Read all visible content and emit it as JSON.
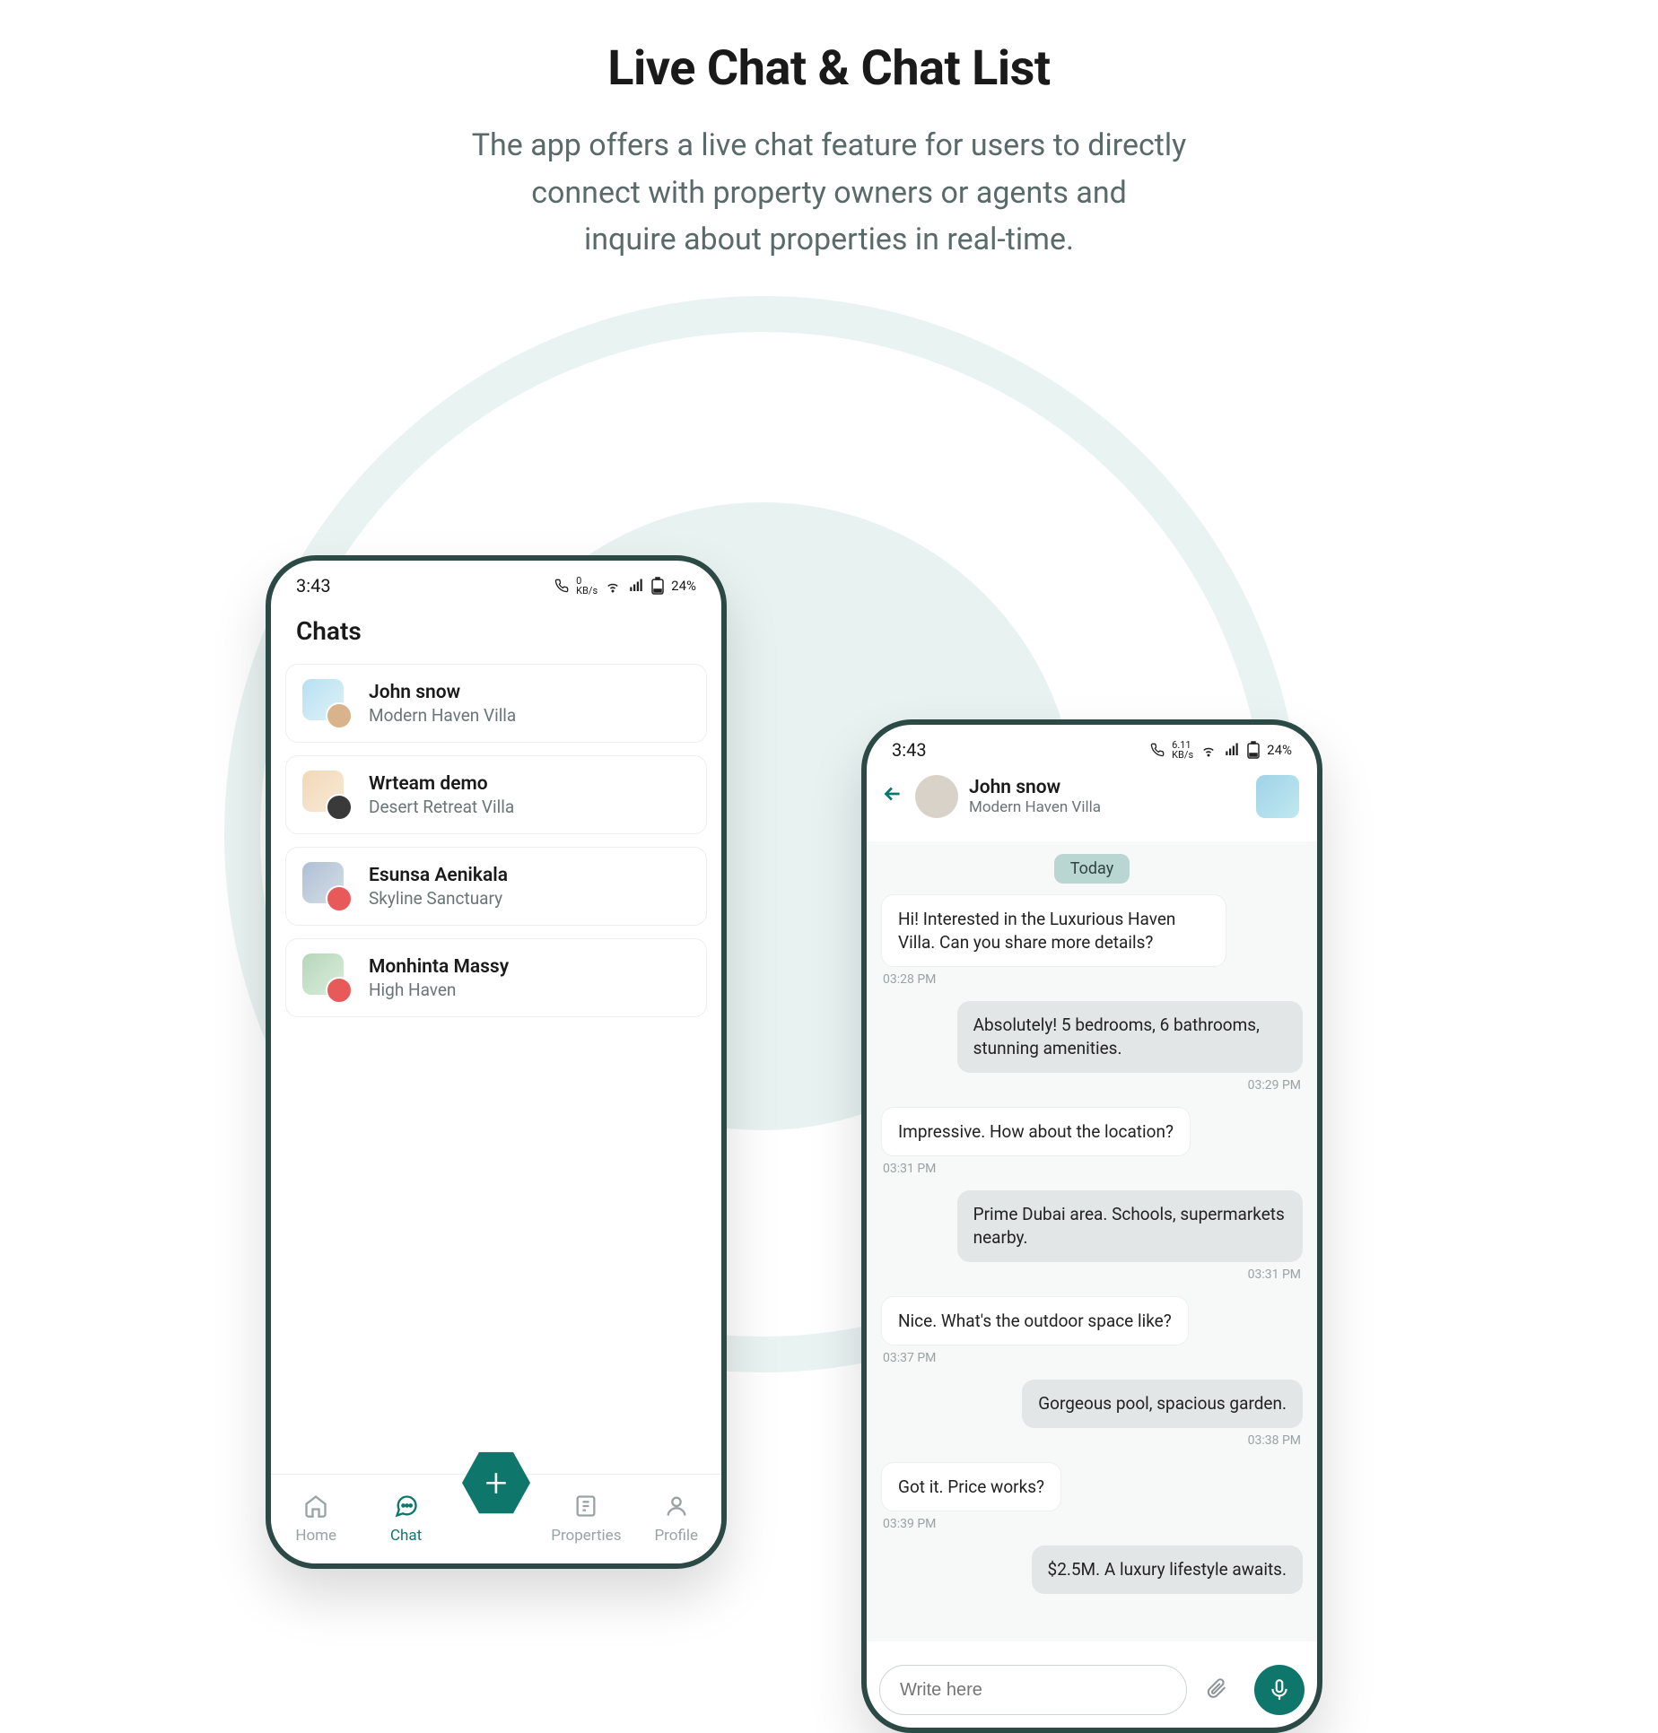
{
  "hero": {
    "title": "Live Chat & Chat List",
    "desc_l1": "The app offers a live chat feature for users to directly",
    "desc_l2": "connect with property owners or agents and",
    "desc_l3": "inquire about properties in real-time."
  },
  "status": {
    "time": "3:43",
    "kb_left": "0",
    "kb_unit": "KB/s",
    "kb_right": "6.11",
    "battery": "24%"
  },
  "chat_list": {
    "title": "Chats",
    "items": [
      {
        "name": "John snow",
        "sub": "Modern Haven Villa"
      },
      {
        "name": "Wrteam demo",
        "sub": "Desert Retreat Villa"
      },
      {
        "name": "Esunsa Aenikala",
        "sub": "Skyline Sanctuary"
      },
      {
        "name": "Monhinta Massy",
        "sub": "High Haven"
      }
    ],
    "nav": {
      "home": "Home",
      "chat": "Chat",
      "properties": "Properties",
      "profile": "Profile"
    }
  },
  "conversation": {
    "name": "John snow",
    "sub": "Modern Haven Villa",
    "day": "Today",
    "messages": [
      {
        "side": "recv",
        "text": "Hi! Interested in the Luxurious Haven Villa. Can you share more details?",
        "time": "03:28 PM"
      },
      {
        "side": "sent",
        "text": "Absolutely! 5 bedrooms, 6 bathrooms, stunning amenities.",
        "time": "03:29 PM"
      },
      {
        "side": "recv",
        "text": "Impressive. How about the location?",
        "time": "03:31 PM"
      },
      {
        "side": "sent",
        "text": "Prime Dubai area. Schools, supermarkets nearby.",
        "time": "03:31 PM"
      },
      {
        "side": "recv",
        "text": "Nice. What's the outdoor space like?",
        "time": "03:37 PM"
      },
      {
        "side": "sent",
        "text": "Gorgeous pool, spacious garden.",
        "time": "03:38 PM"
      },
      {
        "side": "recv",
        "text": "Got it. Price works?",
        "time": "03:39 PM"
      },
      {
        "side": "sent",
        "text": "$2.5M. A luxury lifestyle awaits.",
        "time": ""
      }
    ],
    "composer_placeholder": "Write here"
  }
}
